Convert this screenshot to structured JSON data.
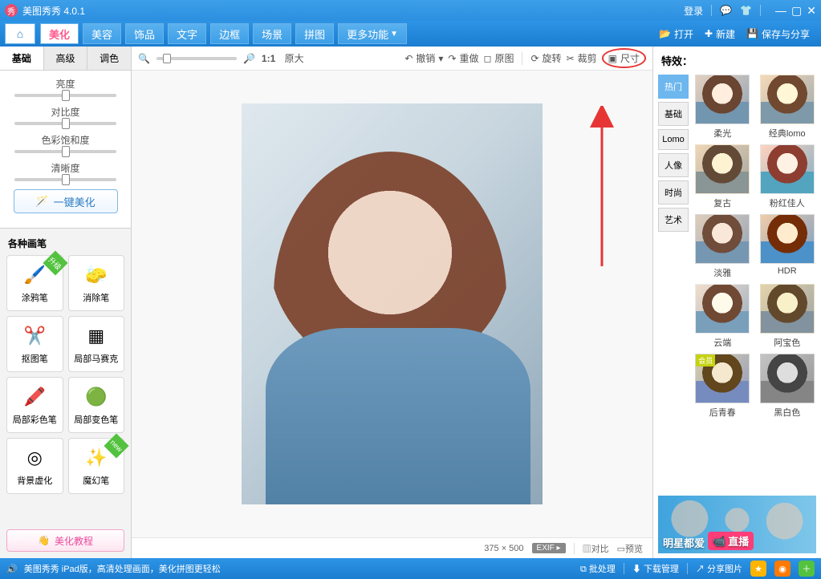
{
  "app": {
    "title": "美图秀秀 4.0.1"
  },
  "titlebar": {
    "login": "登录"
  },
  "menubar": {
    "tabs": [
      "美化",
      "美容",
      "饰品",
      "文字",
      "边框",
      "场景",
      "拼图",
      "更多功能"
    ],
    "actions": {
      "open": "打开",
      "new": "新建",
      "save": "保存与分享"
    }
  },
  "leftPanel": {
    "subtabs": [
      "基础",
      "高级",
      "调色"
    ],
    "sliders": {
      "brightness": "亮度",
      "contrast": "对比度",
      "saturation": "色彩饱和度",
      "sharpness": "清晰度"
    },
    "oneclick": "一键美化",
    "brushTitle": "各种画笔",
    "brushes": [
      {
        "label": "涂鸦笔",
        "icon": "🖌️",
        "badge": "升级"
      },
      {
        "label": "消除笔",
        "icon": "🧽"
      },
      {
        "label": "抠图笔",
        "icon": "✂️"
      },
      {
        "label": "局部马赛克",
        "icon": "▦"
      },
      {
        "label": "局部彩色笔",
        "icon": "🖍️"
      },
      {
        "label": "局部变色笔",
        "icon": "🟢"
      },
      {
        "label": "背景虚化",
        "icon": "◎"
      },
      {
        "label": "魔幻笔",
        "icon": "✨",
        "badge": "new"
      }
    ],
    "tutorial": "美化教程"
  },
  "canvas": {
    "toolbar": {
      "zoom100": "1:1",
      "original": "原大",
      "undo": "撤销",
      "redo": "重做",
      "origImg": "原图",
      "rotate": "旋转",
      "crop": "裁剪",
      "size": "尺寸"
    },
    "status": {
      "dims": "375 × 500",
      "exif": "EXIF",
      "compare": "对比",
      "preview": "预览"
    }
  },
  "effects": {
    "title": "特效：",
    "cats": [
      "热门",
      "基础",
      "Lomo",
      "人像",
      "时尚",
      "艺术"
    ],
    "items": [
      "柔光",
      "经典lomo",
      "复古",
      "粉红佳人",
      "淡雅",
      "HDR",
      "云端",
      "阿宝色",
      "后青春",
      "黑白色"
    ]
  },
  "promo": {
    "text": "明星都爱",
    "live": "直播"
  },
  "bottombar": {
    "tip": "美图秀秀 iPad版，高清处理画面，美化拼图更轻松",
    "batch": "批处理",
    "download": "下载管理",
    "share": "分享图片"
  }
}
